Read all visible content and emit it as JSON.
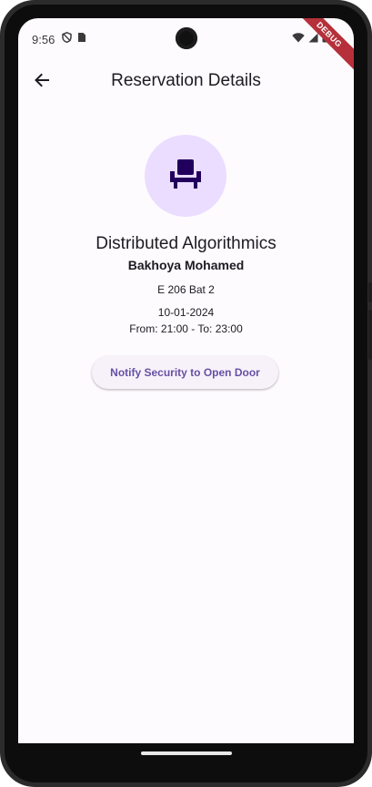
{
  "status_bar": {
    "time": "9:56",
    "left_icons": [
      "shield-icon",
      "sim-card-icon"
    ],
    "right_icons": [
      "wifi-icon",
      "signal-icon",
      "battery-icon"
    ],
    "debug_label": "DEBUG"
  },
  "header": {
    "title": "Reservation Details",
    "back_icon": "arrow-left-icon"
  },
  "reservation": {
    "icon": "seat-icon",
    "course": "Distributed Algorithmics",
    "person": "Bakhoya Mohamed",
    "room": "E 206 Bat 2",
    "date": "10-01-2024",
    "time_range": "From: 21:00 - To: 23:00"
  },
  "actions": {
    "notify_label": "Notify Security to Open Door"
  },
  "colors": {
    "accent": "#6750a4",
    "avatar_bg": "#eaddff",
    "icon_fg": "#21005d",
    "background": "#fefbff",
    "debug_ribbon": "#b5303a"
  }
}
